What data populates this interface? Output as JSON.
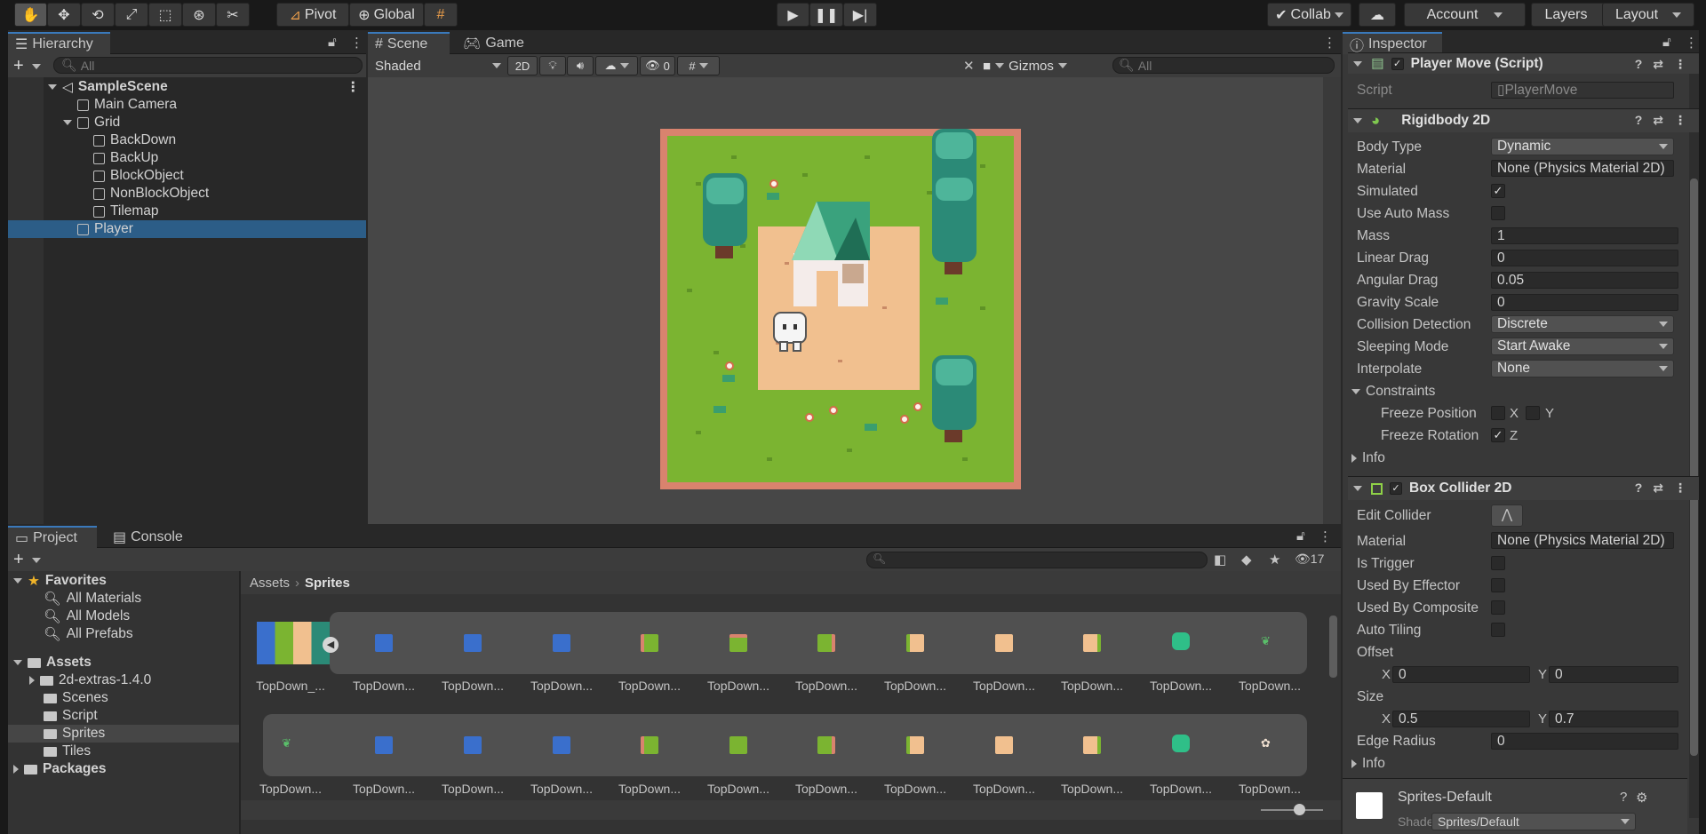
{
  "toolbar": {
    "pivot": "Pivot",
    "global": "Global",
    "collab": "Collab",
    "account": "Account",
    "layers": "Layers",
    "layout": "Layout"
  },
  "hierarchy": {
    "tab": "Hierarchy",
    "search_placeholder": "All",
    "scene": "SampleScene",
    "items": [
      "Main Camera",
      "Grid",
      "BackDown",
      "BackUp",
      "BlockObject",
      "NonBlockObject",
      "Tilemap",
      "Player"
    ]
  },
  "scene_view": {
    "tabs": [
      "Scene",
      "Game"
    ],
    "shading": "Shaded",
    "mode_2d": "2D",
    "hidden_count": "0",
    "gizmos": "Gizmos",
    "search_placeholder": "All"
  },
  "project": {
    "tabs": [
      "Project",
      "Console"
    ],
    "favorites": "Favorites",
    "fav_items": [
      "All Materials",
      "All Models",
      "All Prefabs"
    ],
    "assets": "Assets",
    "asset_folders": [
      "2d-extras-1.4.0",
      "Scenes",
      "Script",
      "Sprites",
      "Tiles"
    ],
    "packages": "Packages",
    "breadcrumb": [
      "Assets",
      "Sprites"
    ],
    "hidden_count": "17",
    "row1_labels": [
      "TopDown_...",
      "TopDown...",
      "TopDown...",
      "TopDown...",
      "TopDown...",
      "TopDown...",
      "TopDown...",
      "TopDown...",
      "TopDown...",
      "TopDown...",
      "TopDown...",
      "TopDown..."
    ],
    "row2_labels": [
      "TopDown...",
      "TopDown...",
      "TopDown...",
      "TopDown...",
      "TopDown...",
      "TopDown...",
      "TopDown...",
      "TopDown...",
      "TopDown...",
      "TopDown...",
      "TopDown...",
      "TopDown..."
    ]
  },
  "inspector": {
    "tab": "Inspector",
    "player_move": {
      "title": "Player Move (Script)",
      "script_label": "Script",
      "script_value": "PlayerMove"
    },
    "rigidbody": {
      "title": "Rigidbody 2D",
      "body_type_label": "Body Type",
      "body_type": "Dynamic",
      "material_label": "Material",
      "material": "None (Physics Material 2D)",
      "simulated_label": "Simulated",
      "auto_mass_label": "Use Auto Mass",
      "mass_label": "Mass",
      "mass": "1",
      "linear_drag_label": "Linear Drag",
      "linear_drag": "0",
      "angular_drag_label": "Angular Drag",
      "angular_drag": "0.05",
      "gravity_label": "Gravity Scale",
      "gravity": "0",
      "collision_label": "Collision Detection",
      "collision": "Discrete",
      "sleeping_label": "Sleeping Mode",
      "sleeping": "Start Awake",
      "interpolate_label": "Interpolate",
      "interpolate": "None",
      "constraints_label": "Constraints",
      "freeze_pos_label": "Freeze Position",
      "freeze_rot_label": "Freeze Rotation",
      "x": "X",
      "y": "Y",
      "z": "Z",
      "info_label": "Info"
    },
    "box_collider": {
      "title": "Box Collider 2D",
      "edit_label": "Edit Collider",
      "material_label": "Material",
      "material": "None (Physics Material 2D)",
      "trigger_label": "Is Trigger",
      "effector_label": "Used By Effector",
      "composite_label": "Used By Composite",
      "auto_tiling_label": "Auto Tiling",
      "offset_label": "Offset",
      "offset_x": "0",
      "offset_y": "0",
      "size_label": "Size",
      "size_x": "0.5",
      "size_y": "0.7",
      "edge_label": "Edge Radius",
      "edge": "0",
      "x": "X",
      "y": "Y",
      "info_label": "Info"
    },
    "material": {
      "name": "Sprites-Default",
      "shader_label": "Shader",
      "shader": "Sprites/Default"
    }
  },
  "colors": {
    "accent": "#2c5d87",
    "grass": "#7bb431",
    "dirt": "#f1c08f",
    "border": "#d9836e",
    "tree": "#2b8a77"
  }
}
